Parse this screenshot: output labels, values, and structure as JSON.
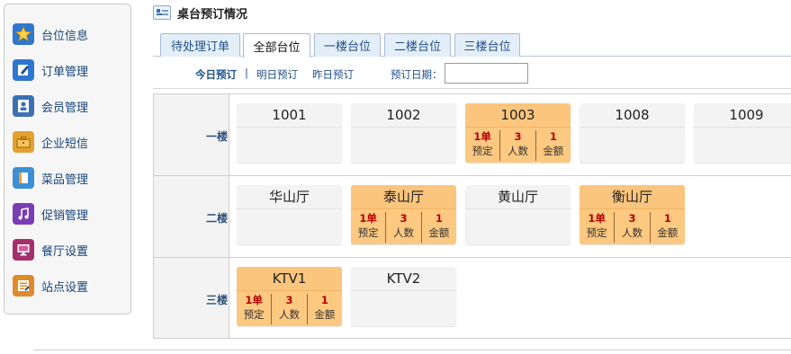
{
  "sidebar": {
    "items": [
      {
        "label": "台位信息",
        "icon": "star-icon",
        "color": "#2f76d1"
      },
      {
        "label": "订单管理",
        "icon": "edit-icon",
        "color": "#2f76d1"
      },
      {
        "label": "会员管理",
        "icon": "member-icon",
        "color": "#3d6fb5"
      },
      {
        "label": "企业短信",
        "icon": "briefcase-icon",
        "color": "#e3a12f"
      },
      {
        "label": "菜品管理",
        "icon": "book-icon",
        "color": "#3b8fd6"
      },
      {
        "label": "促销管理",
        "icon": "music-icon",
        "color": "#7a3db3"
      },
      {
        "label": "餐厅设置",
        "icon": "monitor-icon",
        "color": "#a3306a"
      },
      {
        "label": "站点设置",
        "icon": "settings-icon",
        "color": "#e08a2a"
      }
    ]
  },
  "header": {
    "title": "桌台预订情况"
  },
  "tabs": [
    {
      "label": "待处理订单"
    },
    {
      "label": "全部台位",
      "active": true
    },
    {
      "label": "一楼台位"
    },
    {
      "label": "二楼台位"
    },
    {
      "label": "三楼台位"
    }
  ],
  "filter": {
    "today": "今日预订",
    "separator": "|",
    "tomorrow": "明日预订",
    "yesterday": "昨日预订",
    "date_label": "预订日期：",
    "date_value": ""
  },
  "stat_labels": {
    "booked": "预定",
    "people": "人数",
    "amount": "金额"
  },
  "floors": [
    {
      "label": "一楼",
      "tables": [
        {
          "name": "1001",
          "booked": false
        },
        {
          "name": "1002",
          "booked": false
        },
        {
          "name": "1003",
          "booked": true,
          "orders": "1单",
          "people": "3",
          "amount": "1"
        },
        {
          "name": "1008",
          "booked": false
        },
        {
          "name": "1009",
          "booked": false
        }
      ]
    },
    {
      "label": "二楼",
      "tables": [
        {
          "name": "华山厅",
          "booked": false
        },
        {
          "name": "泰山厅",
          "booked": true,
          "orders": "1单",
          "people": "3",
          "amount": "1"
        },
        {
          "name": "黄山厅",
          "booked": false
        },
        {
          "name": "衡山厅",
          "booked": true,
          "orders": "1单",
          "people": "3",
          "amount": "1"
        }
      ]
    },
    {
      "label": "三楼",
      "tables": [
        {
          "name": "KTV1",
          "booked": true,
          "orders": "1单",
          "people": "3",
          "amount": "1"
        },
        {
          "name": "KTV2",
          "booked": false
        }
      ]
    }
  ],
  "colors": {
    "booked_card": "#fdc880",
    "free_card": "#f3f3f3",
    "stat_value": "#b40000",
    "link": "#1d4f8c"
  }
}
